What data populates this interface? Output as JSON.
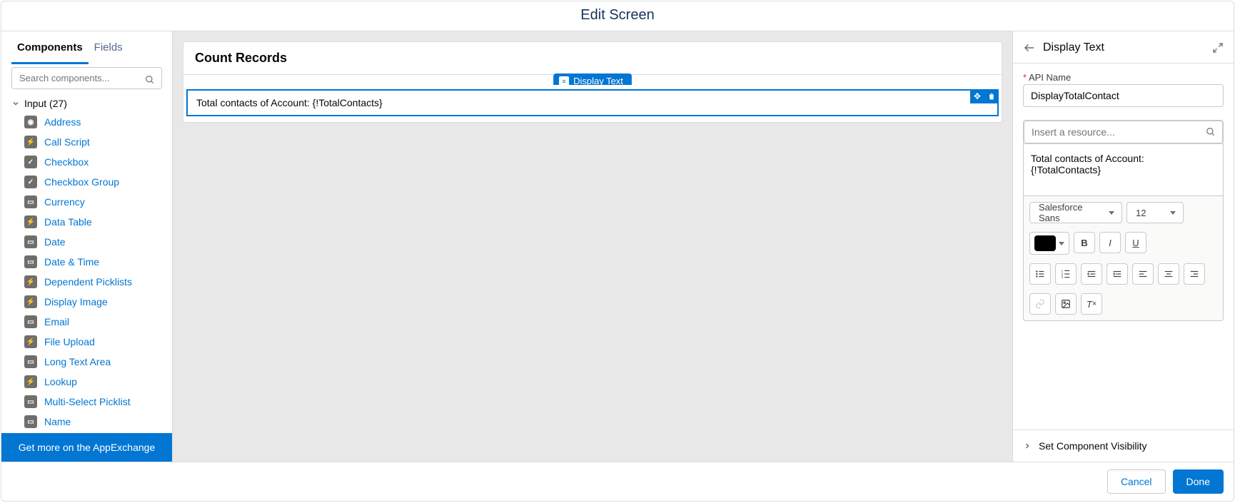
{
  "title": "Edit Screen",
  "tabs": {
    "components": "Components",
    "fields": "Fields"
  },
  "search": {
    "placeholder": "Search components..."
  },
  "section": {
    "input_label": "Input (27)"
  },
  "components": [
    {
      "label": "Address",
      "icon": "◉"
    },
    {
      "label": "Call Script",
      "icon": "⚡"
    },
    {
      "label": "Checkbox",
      "icon": "✓"
    },
    {
      "label": "Checkbox Group",
      "icon": "✓"
    },
    {
      "label": "Currency",
      "icon": "▭"
    },
    {
      "label": "Data Table",
      "icon": "⚡"
    },
    {
      "label": "Date",
      "icon": "▭"
    },
    {
      "label": "Date & Time",
      "icon": "▭"
    },
    {
      "label": "Dependent Picklists",
      "icon": "⚡"
    },
    {
      "label": "Display Image",
      "icon": "⚡"
    },
    {
      "label": "Email",
      "icon": "▭"
    },
    {
      "label": "File Upload",
      "icon": "⚡"
    },
    {
      "label": "Long Text Area",
      "icon": "▭"
    },
    {
      "label": "Lookup",
      "icon": "⚡"
    },
    {
      "label": "Multi-Select Picklist",
      "icon": "▭"
    },
    {
      "label": "Name",
      "icon": "▭"
    }
  ],
  "appexchange": "Get more on the AppExchange",
  "canvas": {
    "heading": "Count Records",
    "pill": "Display Text",
    "selected_text": "Total contacts of Account: {!TotalContacts}"
  },
  "right": {
    "title": "Display Text",
    "api_label": "API Name",
    "api_value": "DisplayTotalContact",
    "resource_placeholder": "Insert a resource...",
    "rich_value": "Total contacts of Account: {!TotalContacts}",
    "font": "Salesforce Sans",
    "size": "12",
    "visibility": "Set Component Visibility"
  },
  "footer": {
    "cancel": "Cancel",
    "done": "Done"
  }
}
